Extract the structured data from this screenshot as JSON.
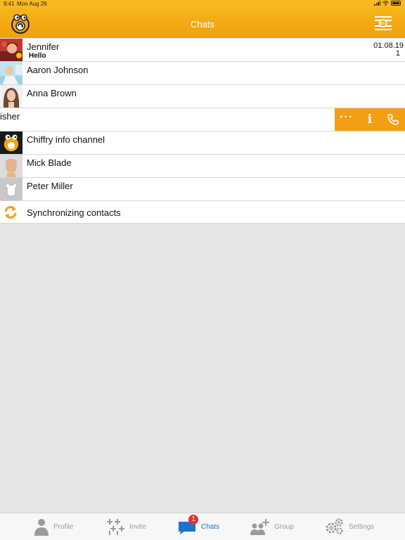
{
  "status": {
    "time": "9:41",
    "date": "Mon Aug 26"
  },
  "header": {
    "title": "Chats"
  },
  "chats": [
    {
      "name": "Jennifer",
      "preview": "Hello",
      "date": "01.08.19",
      "unread": "1"
    },
    {
      "name": "Aaron Johnson"
    },
    {
      "name": "Anna Brown"
    },
    {
      "name": "isher"
    },
    {
      "name": "Chiffry info channel"
    },
    {
      "name": "Mick Blade"
    },
    {
      "name": "Peter Miller"
    }
  ],
  "sync": {
    "label": "Synchronizing contacts"
  },
  "tabs": [
    {
      "label": "Profile"
    },
    {
      "label": "Invite"
    },
    {
      "label": "Chats",
      "badge": "1"
    },
    {
      "label": "Group"
    },
    {
      "label": "Settings"
    }
  ],
  "colors": {
    "accent": "#f7b41c",
    "action": "#f29f16",
    "active_tab": "#1a74d4",
    "badge": "#e53030"
  }
}
